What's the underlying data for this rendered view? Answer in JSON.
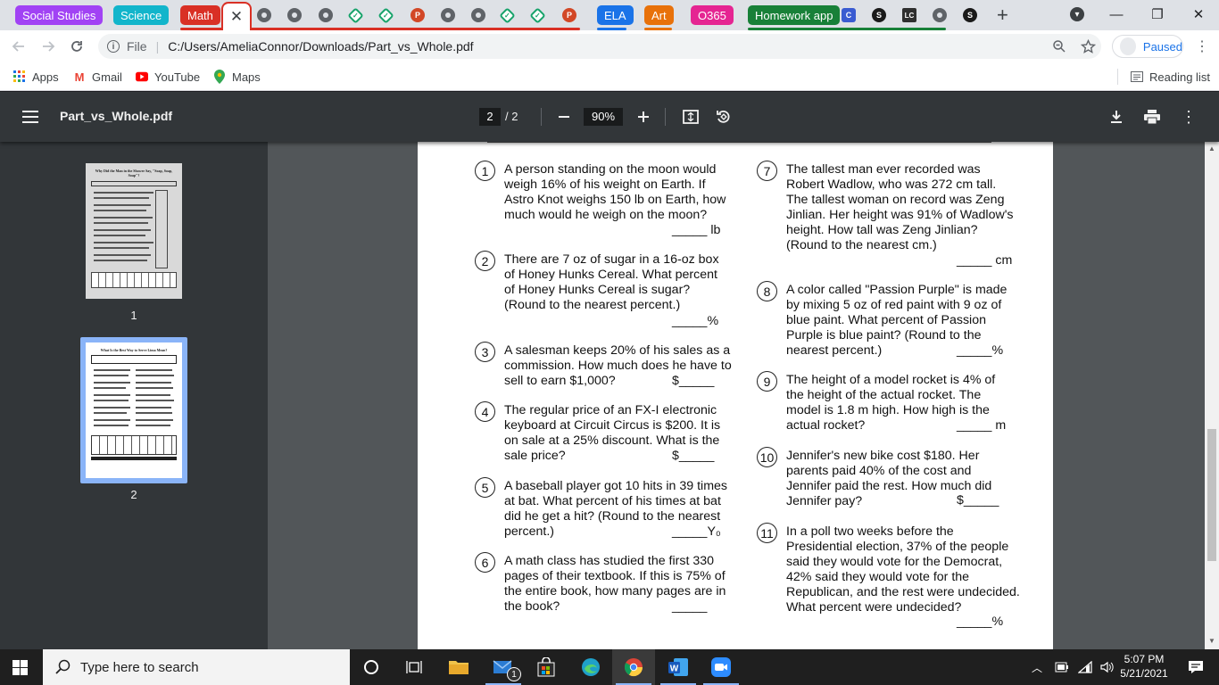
{
  "tabstrip": {
    "groups": [
      {
        "label": "Social Studies",
        "color": "#a142f4"
      },
      {
        "label": "Science",
        "color": "#12b5cb"
      },
      {
        "label": "Math",
        "color": "#d93025"
      },
      {
        "label": "ELA",
        "color": "#1a73e8"
      },
      {
        "label": "Art",
        "color": "#e8710a"
      },
      {
        "label": "O365",
        "color": "#e52592"
      },
      {
        "label": "Homework app",
        "color": "#188038"
      }
    ],
    "active_tab_close": "✕",
    "new_tab": "+",
    "favicon_letters": {
      "ppt": "P",
      "canvas": "C",
      "s": "S",
      "lc": "LC"
    }
  },
  "window_controls": {
    "minimize": "—",
    "maximize": "❐",
    "close": "✕",
    "tab_search": "▾"
  },
  "address_bar": {
    "scheme": "File",
    "url": "C:/Users/AmeliaConnor/Downloads/Part_vs_Whole.pdf",
    "profile_status": "Paused"
  },
  "bookmarks": {
    "items": [
      {
        "label": "Apps",
        "icon": "apps-grid-icon"
      },
      {
        "label": "Gmail",
        "icon": "gmail-icon"
      },
      {
        "label": "YouTube",
        "icon": "youtube-icon"
      },
      {
        "label": "Maps",
        "icon": "maps-icon"
      }
    ],
    "reading_list": "Reading list"
  },
  "pdf_toolbar": {
    "title": "Part_vs_Whole.pdf",
    "current_page": "2",
    "page_of": "/  2",
    "zoom": "90%"
  },
  "thumbnails": [
    {
      "label": "1",
      "heading": "Why Did the Man in the Shower Say, \"Soap, Soap, Soap\"?"
    },
    {
      "label": "2",
      "heading": "What Is the Best Way to Serve Lima Mean?"
    }
  ],
  "worksheet": {
    "questions": [
      {
        "num": "1",
        "text": "A person standing on the moon would weigh 16% of his weight on Earth. If Astro Knot weighs 150 lb on Earth, how much would he weigh on the moon?",
        "answer": "_____ lb"
      },
      {
        "num": "2",
        "text": "There are 7 oz of sugar in a 16-oz box of Honey Hunks Cereal. What percent of Honey Hunks Cereal is sugar? (Round to the nearest percent.)",
        "answer": "_____%"
      },
      {
        "num": "3",
        "text": "A salesman keeps 20% of his sales as a commission. How much does he have to sell to earn $1,000?",
        "answer": "$_____"
      },
      {
        "num": "4",
        "text": "The regular price of an FX-I electronic keyboard at Circuit Circus is $200. It is on sale at a 25% discount. What is the sale price?",
        "answer": "$_____"
      },
      {
        "num": "5",
        "text": "A baseball player got 10 hits in 39 times at bat. What percent of his times at bat did he get a hit? (Round to the nearest percent.)",
        "answer": "_____Y₀"
      },
      {
        "num": "6",
        "text": "A math class has studied the first 330 pages of their textbook. If this is 75% of the entire book, how many pages are in the book?",
        "answer": "_____"
      },
      {
        "num": "7",
        "text": "The tallest man ever recorded was Robert Wadlow, who was 272 cm tall. The tallest woman on record was Zeng Jinlian. Her height was 91% of Wadlow's height. How tall was Zeng Jinlian? (Round to the nearest cm.)",
        "answer": "_____ cm"
      },
      {
        "num": "8",
        "text": "A color called \"Passion Purple\" is made by mixing 5 oz of red paint with 9 oz of blue paint. What percent of Passion Purple is blue paint? (Round to the nearest percent.)",
        "answer": "_____%"
      },
      {
        "num": "9",
        "text": "The height of a model rocket is 4% of the height of the actual rocket. The model is 1.8 m high. How high is the actual rocket?",
        "answer": "_____ m"
      },
      {
        "num": "10",
        "text": "Jennifer's new bike cost $180. Her parents paid 40% of the cost and Jennifer paid the rest. How much did Jennifer pay?",
        "answer": "$_____"
      },
      {
        "num": "11",
        "text": "In a poll two weeks before the Presidential election, 37% of the people said they would vote for the Democrat, 42% said they would vote for the Republican, and the rest were undecided. What percent were undecided?",
        "answer": "_____%"
      }
    ]
  },
  "taskbar": {
    "search_placeholder": "Type here to search",
    "mail_badge": "1",
    "time": "5:07 PM",
    "date": "5/21/2021"
  }
}
